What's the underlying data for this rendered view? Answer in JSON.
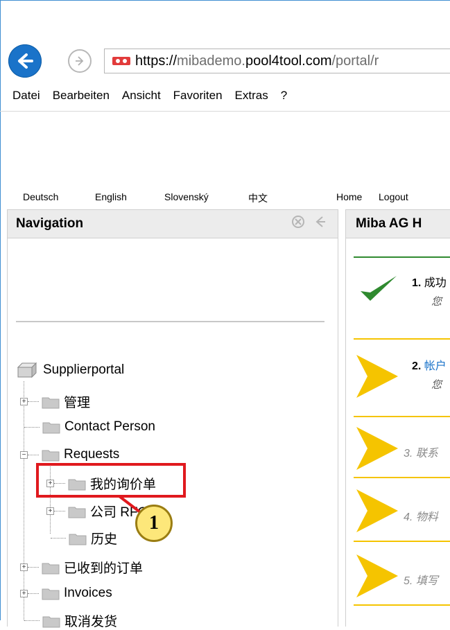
{
  "browser": {
    "url_scheme": "https://",
    "url_sub": "mibademo.",
    "url_domain": "pool4tool.com",
    "url_path": "/portal/r"
  },
  "menubar": [
    "Datei",
    "Bearbeiten",
    "Ansicht",
    "Favoriten",
    "Extras",
    "?"
  ],
  "langbar": {
    "items": [
      "Deutsch",
      "English",
      "Slovenský",
      "中文"
    ],
    "home": "Home",
    "logout": "Logout"
  },
  "nav": {
    "title": "Navigation",
    "tree": {
      "root": "Supplierportal",
      "items": [
        {
          "label": "管理",
          "expander": "+"
        },
        {
          "label": "Contact Person",
          "expander": ""
        },
        {
          "label": "Requests",
          "expander": "−"
        },
        {
          "label": "我的询价单",
          "expander": "+"
        },
        {
          "label": "公司 RFQ",
          "expander": "+"
        },
        {
          "label": "历史",
          "expander": ""
        },
        {
          "label": "已收到的订单",
          "expander": "+"
        },
        {
          "label": "Invoices",
          "expander": "+"
        },
        {
          "label": "取消发货",
          "expander": ""
        }
      ]
    },
    "callout_number": "1"
  },
  "main": {
    "title": "Miba AG H",
    "steps": [
      {
        "number": "1.",
        "label": "成功",
        "sub": "您",
        "state": "done"
      },
      {
        "number": "2.",
        "label": "帐户",
        "sub": "您",
        "state": "current"
      },
      {
        "number": "3.",
        "label": "联系",
        "state": "pending"
      },
      {
        "number": "4.",
        "label": "物料",
        "state": "pending"
      },
      {
        "number": "5.",
        "label": "填写",
        "state": "pending"
      }
    ]
  },
  "colors": {
    "accent_blue": "#1a73c9",
    "highlight_red": "#e0191e",
    "step_green": "#2f8a2f",
    "step_yellow": "#f5c400"
  }
}
